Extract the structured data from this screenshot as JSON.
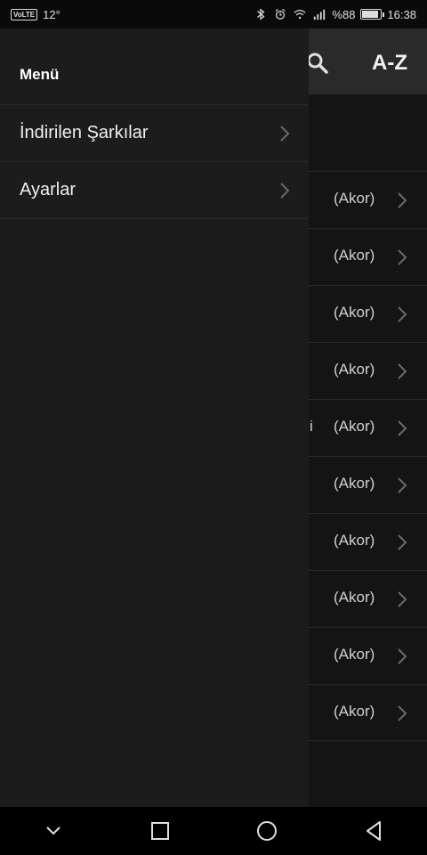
{
  "status_bar": {
    "carrier_badge": "VoLTE",
    "temperature": "12°",
    "battery_percent": "%88",
    "battery_level": 0.88,
    "time": "16:38"
  },
  "header": {
    "sort_label": "A-Z"
  },
  "list": {
    "rows": [
      {
        "prefix": "",
        "chord": "(Akor)"
      },
      {
        "prefix": "",
        "chord": "(Akor)"
      },
      {
        "prefix": "",
        "chord": "(Akor)"
      },
      {
        "prefix": "",
        "chord": "(Akor)"
      },
      {
        "prefix": "i",
        "chord": "(Akor)"
      },
      {
        "prefix": "",
        "chord": "(Akor)"
      },
      {
        "prefix": "",
        "chord": "(Akor)"
      },
      {
        "prefix": "",
        "chord": "(Akor)"
      },
      {
        "prefix": "",
        "chord": "(Akor)"
      },
      {
        "prefix": "",
        "chord": "(Akor)"
      }
    ]
  },
  "drawer": {
    "title": "Menü",
    "items": [
      {
        "label": "İndirilen Şarkılar"
      },
      {
        "label": "Ayarlar"
      }
    ]
  },
  "nav_bar": {
    "icons": [
      "collapse-icon",
      "recent-apps-icon",
      "home-icon",
      "back-icon"
    ]
  },
  "colors": {
    "background": "#141414",
    "drawer": "#1c1c1c",
    "header": "#2a2a2a",
    "text": "#e6e6e6"
  }
}
